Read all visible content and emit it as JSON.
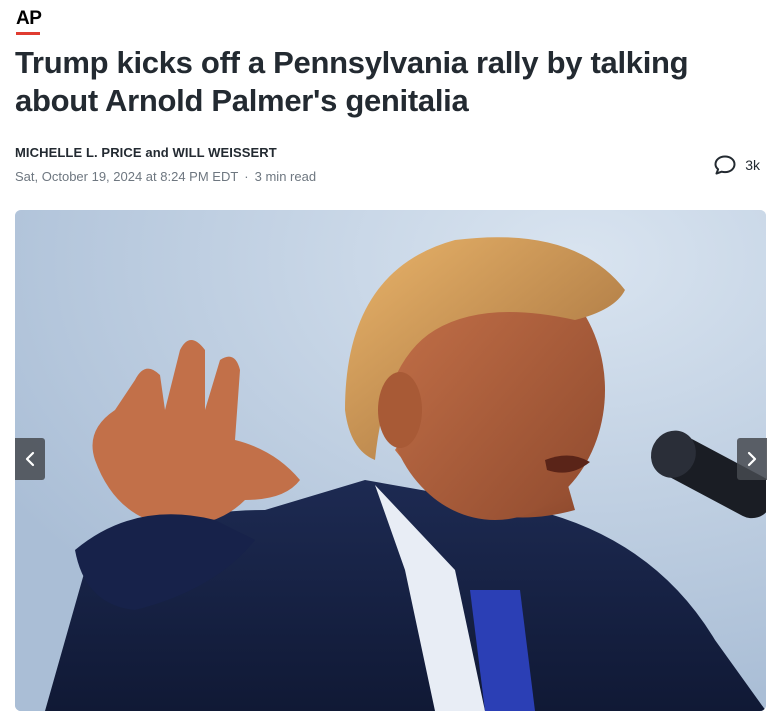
{
  "publisher": {
    "name": "AP"
  },
  "article": {
    "headline": "Trump kicks off a Pennsylvania rally by talking about Arnold Palmer's genitalia",
    "byline": "MICHELLE L. PRICE and WILL WEISSERT",
    "date": "Sat, October 19, 2024 at 8:24 PM EDT",
    "separator": "·",
    "read_time": "3 min read"
  },
  "comments": {
    "count": "3k",
    "icon": "speech-bubble-icon"
  },
  "gallery": {
    "prev_icon": "chevron-left-icon",
    "next_icon": "chevron-right-icon"
  },
  "colors": {
    "accent": "#e03c31",
    "text": "#232a31",
    "meta": "#6e7780",
    "nav_bg": "#464a50"
  }
}
